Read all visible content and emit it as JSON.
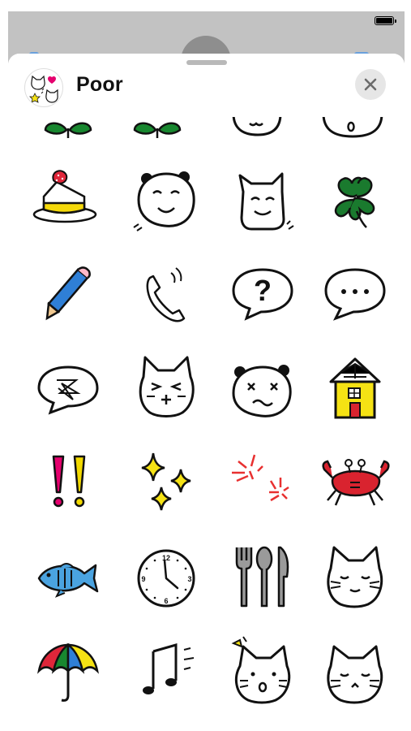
{
  "sheet": {
    "title": "Poor",
    "close_icon": "close-x-icon"
  },
  "stickers": [
    "sprout-icon",
    "sprout-icon",
    "face-cropped-icon",
    "face-o-mouth-cropped-icon",
    "strawberry-cake-icon",
    "panda-smile-icon",
    "dog-smile-icon",
    "four-leaf-clover-icon",
    "pencil-icon",
    "telephone-icon",
    "question-bubble-icon",
    "ellipsis-bubble-icon",
    "scribble-bubble-icon",
    "cat-frown-icon",
    "panda-dizzy-icon",
    "yellow-house-icon",
    "double-exclamation-icon",
    "sparkles-icon",
    "anger-marks-icon",
    "red-crab-icon",
    "blue-fish-icon",
    "clock-icon",
    "fork-spoon-knife-icon",
    "cat-content-icon",
    "umbrella-icon",
    "music-notes-icon",
    "cat-surprised-icon",
    "cat-sleepy-icon"
  ],
  "colors": {
    "status_bar": "#c2c2c2",
    "clover_green": "#1a7a2e",
    "pencil_blue": "#2f7fd6",
    "house_yellow": "#f5e214",
    "exclamation_pink": "#e5006e",
    "exclamation_yellow": "#f2d900",
    "anger_red": "#e83030",
    "crab_red": "#d9232f",
    "fish_blue": "#4aa3e0"
  }
}
